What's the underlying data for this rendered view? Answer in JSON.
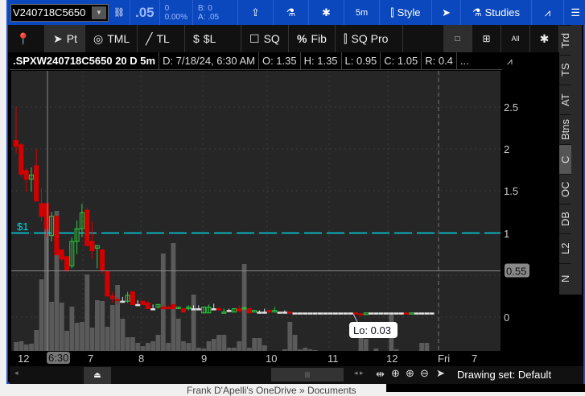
{
  "toolbar": {
    "symbol": "V240718C5650",
    "last": ".05",
    "change": "0",
    "change_pct": "0.00%",
    "bid": "B: 0",
    "ask": "A: .05",
    "timeframe": "5m",
    "style": "Style",
    "studies": "Studies"
  },
  "drawing_tools": [
    {
      "icon": "pin-icon",
      "label": ""
    },
    {
      "icon": "cursor-icon",
      "label": "Pt"
    },
    {
      "icon": "tml-icon",
      "label": "TML"
    },
    {
      "icon": "trendline-icon",
      "label": "TL"
    },
    {
      "icon": "dollar-line-icon",
      "label": "$L"
    },
    {
      "icon": "square-icon",
      "label": "SQ"
    },
    {
      "icon": "percent-icon",
      "label": "Fib"
    },
    {
      "icon": "candles-icon",
      "label": "SQ Pro"
    }
  ],
  "info": {
    "symbol": ".SPXW240718C5650 20 D 5m",
    "date": "D: 7/18/24, 6:30 AM",
    "open": "O: 1.35",
    "high": "H: 1.35",
    "low": "L: 0.95",
    "close": "C: 1.05",
    "range": "R: 0.4",
    "more": "..."
  },
  "side_tabs": [
    "Trd",
    "TS",
    "AT",
    "Btns",
    "C",
    "OC",
    "DB",
    "L2",
    "N"
  ],
  "active_side_tab": "C",
  "chart_data": {
    "type": "candlestick",
    "y_ticks": [
      "2.5",
      "2",
      "1.5",
      "1",
      "0"
    ],
    "y_range": [
      -0.4,
      2.95
    ],
    "x_ticks": [
      "12",
      "7",
      "8",
      "9",
      "10",
      "11",
      "12",
      "Fri",
      "7"
    ],
    "crosshair": {
      "time": "6:30",
      "price": "0.55"
    },
    "price_line": {
      "label": "$1",
      "value": 1,
      "color": "#00d8e8"
    },
    "low_bubble": "Lo: 0.03",
    "candles": [
      [
        2.1,
        2.5,
        1.95,
        2.03
      ],
      [
        2.05,
        2.07,
        1.66,
        1.7
      ],
      [
        1.74,
        1.77,
        1.49,
        1.64
      ],
      [
        1.64,
        1.78,
        1.49,
        1.69
      ],
      [
        1.8,
        2.0,
        1.38,
        1.38
      ],
      [
        1.35,
        1.53,
        1.14,
        1.2
      ],
      [
        1.35,
        1.35,
        0.95,
        1.05
      ],
      [
        0.97,
        1.25,
        0.9,
        1.2
      ],
      [
        1.2,
        1.2,
        0.74,
        0.74
      ],
      [
        0.8,
        0.8,
        0.66,
        0.69
      ],
      [
        0.72,
        0.72,
        0.54,
        0.56
      ],
      [
        0.61,
        0.95,
        0.58,
        0.9
      ],
      [
        0.9,
        1.15,
        0.75,
        1.05
      ],
      [
        1.05,
        1.35,
        0.95,
        1.24
      ],
      [
        1.27,
        1.3,
        0.85,
        0.85
      ],
      [
        0.9,
        1.14,
        0.69,
        0.79
      ],
      [
        0.82,
        0.85,
        0.58,
        0.85
      ],
      [
        0.8,
        0.8,
        0.52,
        0.56
      ],
      [
        0.55,
        0.55,
        0.25,
        0.25
      ],
      [
        0.25,
        0.3,
        0.17,
        0.22
      ],
      [
        0.21,
        0.24,
        0.15,
        0.2
      ],
      [
        0.19,
        0.24,
        0.19,
        0.19
      ],
      [
        0.19,
        0.3,
        0.17,
        0.26
      ],
      [
        0.3,
        0.3,
        0.15,
        0.15
      ],
      [
        0.15,
        0.2,
        0.15,
        0.15
      ],
      [
        0.19,
        0.19,
        0.15,
        0.15
      ],
      [
        0.17,
        0.19,
        0.1,
        0.1
      ],
      [
        0.1,
        0.15,
        0.1,
        0.1
      ],
      [
        0.12,
        0.15,
        0.1,
        0.15
      ],
      [
        0.12,
        0.14,
        0.1,
        0.1
      ],
      [
        0.12,
        0.14,
        0.1,
        0.1
      ],
      [
        0.15,
        0.15,
        0.1,
        0.1
      ],
      [
        0.1,
        0.12,
        0.1,
        0.12
      ],
      [
        0.1,
        0.1,
        0.06,
        0.06
      ],
      [
        0.1,
        0.14,
        0.08,
        0.12
      ],
      [
        0.1,
        0.14,
        0.1,
        0.1
      ],
      [
        0.1,
        0.14,
        0.1,
        0.1
      ],
      [
        0.05,
        0.12,
        0.05,
        0.12
      ],
      [
        0.05,
        0.15,
        0.05,
        0.12
      ],
      [
        0.1,
        0.16,
        0.1,
        0.1
      ],
      [
        0.1,
        0.12,
        0.08,
        0.09
      ],
      [
        0.05,
        0.1,
        0.05,
        0.06
      ],
      [
        0.08,
        0.1,
        0.08,
        0.08
      ],
      [
        0.06,
        0.1,
        0.06,
        0.1
      ],
      [
        0.1,
        0.14,
        0.06,
        0.07
      ],
      [
        0.1,
        0.12,
        0.1,
        0.11
      ],
      [
        0.1,
        0.1,
        0.05,
        0.05
      ],
      [
        0.06,
        0.08,
        0.06,
        0.08
      ],
      [
        0.06,
        0.08,
        0.06,
        0.06
      ],
      [
        0.06,
        0.1,
        0.06,
        0.06
      ],
      [
        0.08,
        0.08,
        0.06,
        0.06
      ],
      [
        0.06,
        0.12,
        0.06,
        0.08
      ],
      [
        0.06,
        0.06,
        0.06,
        0.06
      ],
      [
        0.06,
        0.08,
        0.06,
        0.06
      ],
      [
        0.06,
        0.06,
        0.05,
        0.05
      ],
      [
        0.05,
        0.05,
        0.05,
        0.05
      ],
      [
        0.05,
        0.05,
        0.05,
        0.05
      ],
      [
        0.05,
        0.05,
        0.05,
        0.05
      ],
      [
        0.05,
        0.05,
        0.05,
        0.05
      ],
      [
        0.05,
        0.05,
        0.05,
        0.05
      ],
      [
        0.05,
        0.05,
        0.05,
        0.05
      ],
      [
        0.05,
        0.05,
        0.05,
        0.05
      ],
      [
        0.05,
        0.05,
        0.05,
        0.05
      ],
      [
        0.05,
        0.05,
        0.05,
        0.05
      ],
      [
        0.05,
        0.05,
        0.05,
        0.05
      ],
      [
        0.05,
        0.05,
        0.05,
        0.05
      ],
      [
        0.05,
        0.05,
        0.05,
        0.05
      ],
      [
        0.05,
        0.05,
        0.04,
        0.04
      ],
      [
        0.04,
        0.04,
        0.03,
        0.03
      ],
      [
        0.03,
        0.05,
        0.03,
        0.05
      ],
      [
        0.05,
        0.05,
        0.05,
        0.05
      ],
      [
        0.05,
        0.05,
        0.05,
        0.05
      ],
      [
        0.05,
        0.05,
        0.05,
        0.05
      ],
      [
        0.05,
        0.05,
        0.05,
        0.05
      ],
      [
        0.05,
        0.05,
        0.05,
        0.05
      ],
      [
        0.05,
        0.05,
        0.05,
        0.05
      ],
      [
        0.05,
        0.05,
        0.05,
        0.05
      ],
      [
        0.05,
        0.05,
        0.04,
        0.04
      ],
      [
        0.04,
        0.05,
        0.04,
        0.05
      ],
      [
        0.05,
        0.05,
        0.05,
        0.05
      ],
      [
        0.05,
        0.05,
        0.05,
        0.05
      ],
      [
        0.05,
        0.05,
        0.05,
        0.05
      ],
      [
        0.05,
        0.05,
        0.05,
        0.05
      ]
    ],
    "volume": [
      11,
      12,
      8,
      9,
      26,
      89,
      173,
      61,
      174,
      60,
      25,
      55,
      35,
      36,
      95,
      29,
      63,
      62,
      30,
      57,
      82,
      40,
      17,
      17,
      10,
      6,
      10,
      12,
      20,
      121,
      10,
      134,
      40,
      12,
      10,
      70,
      4,
      3,
      12,
      15,
      20,
      20,
      4,
      4,
      12,
      108,
      4,
      16,
      16,
      7,
      0,
      0,
      0,
      2,
      36,
      20,
      2,
      4,
      2,
      1,
      0,
      0,
      0,
      0,
      0,
      0,
      0,
      0,
      30,
      15,
      0,
      3,
      0,
      0,
      45,
      2,
      0,
      0,
      0,
      0,
      10,
      10,
      0
    ],
    "colors": {
      "up": "#2ecc40",
      "down": "#d40000",
      "doji": "#e0e0e0",
      "volume": "#5a5a5a",
      "background": "#262626"
    }
  },
  "footer": {
    "drawing_set": "Drawing set: Default",
    "behind_text": "Frank D'Apelli's OneDrive » Documents"
  }
}
